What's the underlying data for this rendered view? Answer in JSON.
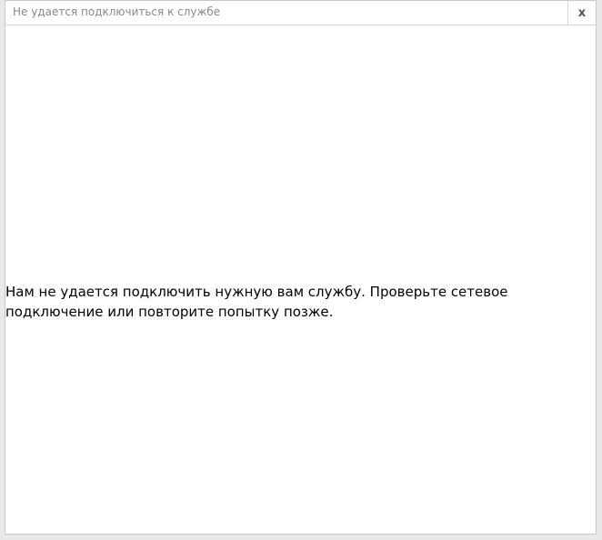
{
  "window": {
    "title": "Не удается подключиться к службе",
    "close_label": "x"
  },
  "content": {
    "message": "Нам не удается подключить нужную вам службу. Проверьте сетевое подключение или повторите попытку позже."
  },
  "colors": {
    "background": "#ffffff",
    "frame": "#e9e9ec",
    "title_text": "#8a8a8a",
    "message_text": "#000000"
  }
}
